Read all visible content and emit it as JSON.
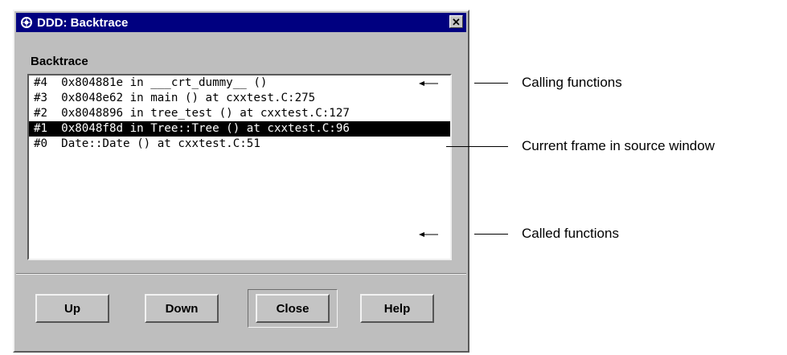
{
  "window": {
    "title": "DDD: Backtrace",
    "close_glyph": "✕"
  },
  "backtrace": {
    "label": "Backtrace",
    "frames": [
      {
        "text": "#4  0x804881e in ___crt_dummy__ ()",
        "selected": false
      },
      {
        "text": "#3  0x8048e62 in main () at cxxtest.C:275",
        "selected": false
      },
      {
        "text": "#2  0x8048896 in tree_test () at cxxtest.C:127",
        "selected": false
      },
      {
        "text": "#1  0x8048f8d in Tree::Tree () at cxxtest.C:96",
        "selected": true
      },
      {
        "text": "#0  Date::Date () at cxxtest.C:51",
        "selected": false
      }
    ]
  },
  "buttons": {
    "up": "Up",
    "down": "Down",
    "close": "Close",
    "help": "Help"
  },
  "annotations": {
    "calling": "Calling functions",
    "current": "Current frame in source window",
    "called": "Called functions"
  },
  "colors": {
    "titlebar": "#000080",
    "dialog": "#bebebe",
    "selection": "#000000"
  },
  "icons": {
    "title": "ddd-logo-icon",
    "close": "close-icon"
  }
}
